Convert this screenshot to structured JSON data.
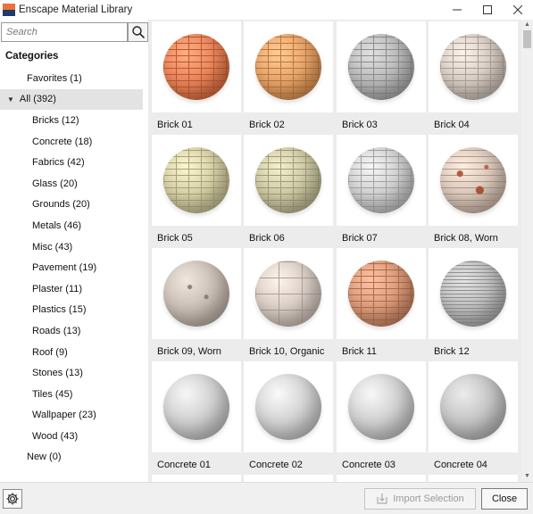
{
  "window": {
    "title": "Enscape Material Library",
    "controls": {
      "minimize": "—",
      "maximize": "☐",
      "close": "✕"
    }
  },
  "search": {
    "placeholder": "Search",
    "value": "",
    "icon": "search-icon"
  },
  "categories": {
    "heading": "Categories",
    "favorites": "Favorites (1)",
    "all": "All (392)",
    "children": [
      "Bricks (12)",
      "Concrete (18)",
      "Fabrics (42)",
      "Glass (20)",
      "Grounds (20)",
      "Metals (46)",
      "Misc (43)",
      "Pavement (19)",
      "Plaster (11)",
      "Plastics (15)",
      "Roads (13)",
      "Roof (9)",
      "Stones (13)",
      "Tiles (45)",
      "Wallpaper (23)",
      "Wood (43)"
    ],
    "new": "New (0)"
  },
  "materials": [
    {
      "name": "Brick 01",
      "color": "#e8855c",
      "pattern": "brick"
    },
    {
      "name": "Brick 02",
      "color": "#e6a46b",
      "pattern": "brick"
    },
    {
      "name": "Brick 03",
      "color": "#b9b9b9",
      "pattern": "brick-dark"
    },
    {
      "name": "Brick 04",
      "color": "#d6cbc2",
      "pattern": "brick"
    },
    {
      "name": "Brick 05",
      "color": "#d5cfa7",
      "pattern": "brick"
    },
    {
      "name": "Brick 06",
      "color": "#ccc8a5",
      "pattern": "brick"
    },
    {
      "name": "Brick 07",
      "color": "#cfcfcf",
      "pattern": "brick"
    },
    {
      "name": "Brick 08, Worn",
      "color": "#d9c6b9",
      "pattern": "worn"
    },
    {
      "name": "Brick 09, Worn",
      "color": "#c9beb5",
      "pattern": "speckle"
    },
    {
      "name": "Brick 10, Organic",
      "color": "#d8ccc4",
      "pattern": "block"
    },
    {
      "name": "Brick 11",
      "color": "#d99a7a",
      "pattern": "brick"
    },
    {
      "name": "Brick 12",
      "color": "#bdbdbd",
      "pattern": "fine"
    },
    {
      "name": "Concrete 01",
      "color": "#cfcfcf",
      "pattern": "plain"
    },
    {
      "name": "Concrete 02",
      "color": "#d2d2d2",
      "pattern": "plain"
    },
    {
      "name": "Concrete 03",
      "color": "#d0d0d0",
      "pattern": "plain"
    },
    {
      "name": "Concrete 04",
      "color": "#c4c4c4",
      "pattern": "plain-dark"
    }
  ],
  "footer": {
    "settings_icon": "gear-icon",
    "import_label": "Import Selection",
    "close_label": "Close"
  }
}
